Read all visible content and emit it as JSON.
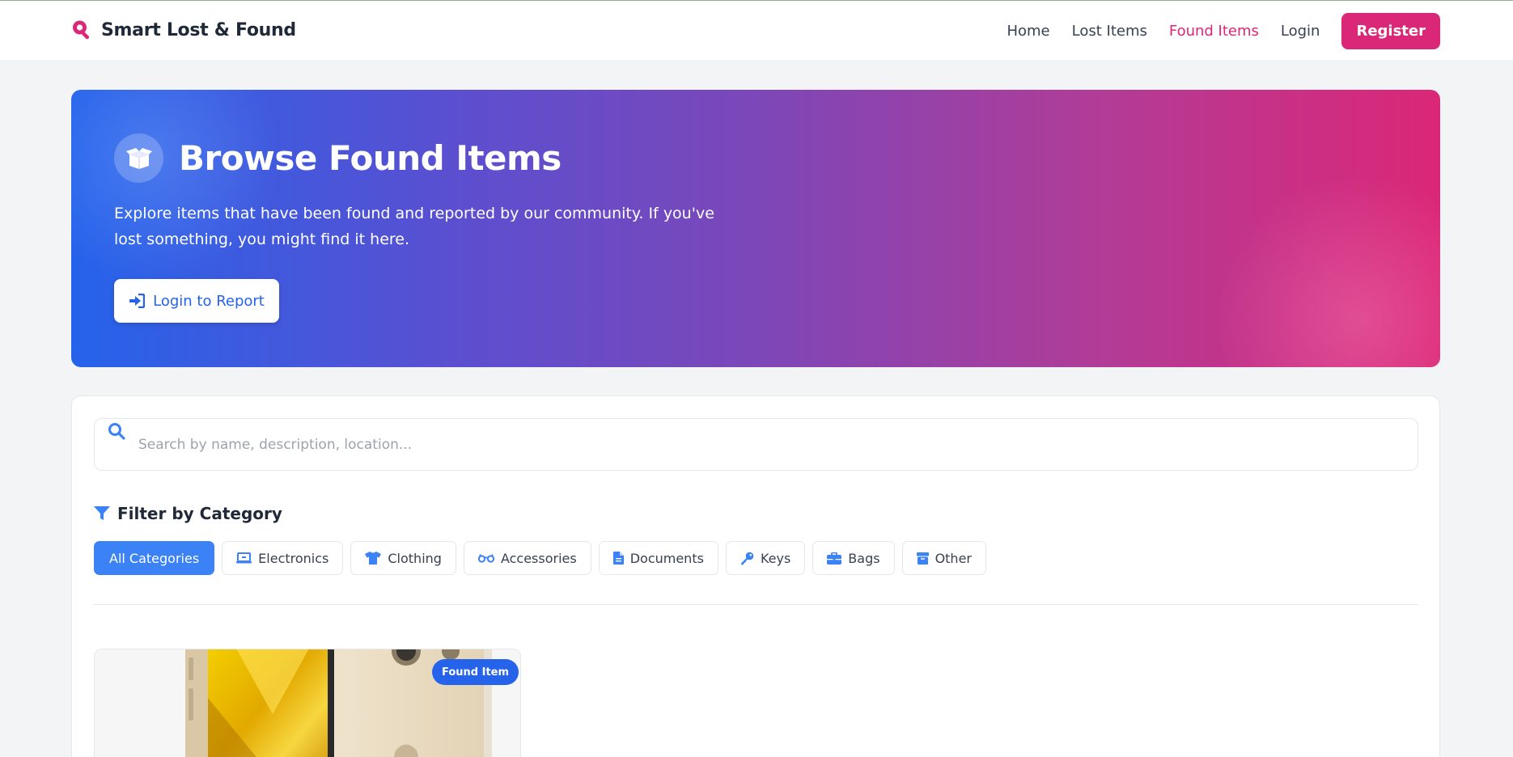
{
  "navbar": {
    "brand": "Smart Lost & Found",
    "links": [
      {
        "label": "Home",
        "active": false
      },
      {
        "label": "Lost Items",
        "active": false
      },
      {
        "label": "Found Items",
        "active": true
      },
      {
        "label": "Login",
        "active": false
      }
    ],
    "register_label": "Register"
  },
  "hero": {
    "icon": "box-open-icon",
    "title": "Browse Found Items",
    "description": "Explore items that have been found and reported by our community. If you've lost something, you might find it here.",
    "cta_label": "Login to Report"
  },
  "search": {
    "placeholder": "Search by name, description, location...",
    "value": ""
  },
  "filter": {
    "title": "Filter by Category",
    "categories": [
      {
        "label": "All Categories",
        "icon": null,
        "active": true
      },
      {
        "label": "Electronics",
        "icon": "laptop-icon",
        "active": false
      },
      {
        "label": "Clothing",
        "icon": "shirt-icon",
        "active": false
      },
      {
        "label": "Accessories",
        "icon": "glasses-icon",
        "active": false
      },
      {
        "label": "Documents",
        "icon": "document-icon",
        "active": false
      },
      {
        "label": "Keys",
        "icon": "key-icon",
        "active": false
      },
      {
        "label": "Bags",
        "icon": "briefcase-icon",
        "active": false
      },
      {
        "label": "Other",
        "icon": "box-icon",
        "active": false
      }
    ]
  },
  "items": [
    {
      "badge": "Found Item",
      "image": "smartphone-photo"
    }
  ],
  "colors": {
    "brand_pink": "#db2777",
    "primary_blue": "#2563eb",
    "chip_active": "#3b82f6",
    "icon_blue": "#3b82f6"
  }
}
